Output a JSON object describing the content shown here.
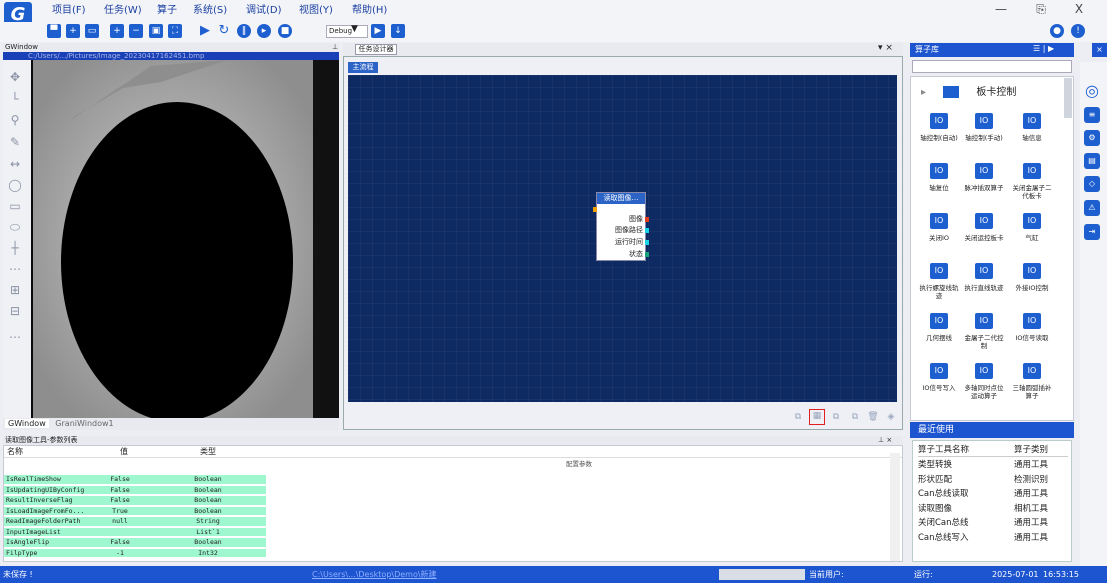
{
  "menu": [
    "项目(F)",
    "任务(W)",
    "算子",
    "系统(S)",
    "调试(D)",
    "视图(Y)",
    "帮助(H)"
  ],
  "window_controls": {
    "minimize": "—",
    "restore": "⎘",
    "close": "X"
  },
  "toolbar": {
    "debug_select": "Debug",
    "icons": [
      "save-icon",
      "new-icon",
      "open-icon",
      "zoom-in-icon",
      "zoom-out-icon",
      "fit-icon",
      "fullscreen-icon",
      "run-icon",
      "loop-icon",
      "pause-icon",
      "step-icon",
      "stop-icon",
      "run-single-icon",
      "export-icon"
    ]
  },
  "gwindow": {
    "title": "GWindow",
    "path": "C:/Users/.../Pictures/Image_20230417162451.bmp",
    "tabs": [
      "GWindow",
      "GraniWindow1"
    ]
  },
  "designer": {
    "tab": "任务设计器",
    "flow_tab": "主流程",
    "node": {
      "title": "读取图像…",
      "ports": [
        "图像",
        "图像路径",
        "运行时间",
        "状态"
      ]
    }
  },
  "library": {
    "title": "算子库",
    "category": "板卡控制",
    "operators": [
      "轴控制(自动)",
      "轴控制(手动)",
      "轴信息",
      "轴复位",
      "脉冲插双算子",
      "关闭金屠子二代板卡",
      "关闭IO",
      "关闭运控板卡",
      "气缸",
      "执行螺旋线轨迹",
      "执行直线轨迹",
      "外接IO控制",
      "几何摆线",
      "金屠子二代控制",
      "IO信号读取",
      "IO信号写入",
      "多轴同时点位运动算子",
      "三轴圆弧插补算子"
    ]
  },
  "recent": {
    "title": "最近使用",
    "headers": [
      "算子工具名称",
      "算子类别"
    ],
    "rows": [
      [
        "类型转换",
        "通用工具"
      ],
      [
        "形状匹配",
        "检测识别"
      ],
      [
        "Can总线读取",
        "通用工具"
      ],
      [
        "读取图像",
        "相机工具"
      ],
      [
        "关闭Can总线",
        "通用工具"
      ],
      [
        "Can总线写入",
        "通用工具"
      ]
    ]
  },
  "params": {
    "title": "读取图像工具-参数列表",
    "headers": [
      "名称",
      "值",
      "类型"
    ],
    "section": "配置参数",
    "rows": [
      [
        "IsRealTimeShow",
        "False",
        "Boolean"
      ],
      [
        "IsUpdatingUIByConfig",
        "False",
        "Boolean"
      ],
      [
        "ResultInverseFlag",
        "False",
        "Boolean"
      ],
      [
        "IsLoadImageFromFo...",
        "True",
        "Boolean"
      ],
      [
        "ReadImageFolderPath",
        "null",
        "String"
      ],
      [
        "InputImageList",
        "",
        "List`1"
      ],
      [
        "IsAngleFlip",
        "False",
        "Boolean"
      ],
      [
        "FilpType",
        "-1",
        "Int32"
      ]
    ]
  },
  "status": {
    "left": "未保存 !",
    "path": "C:\\Users\\...\\Desktop\\Demo\\新建",
    "user_label": "当前用户:",
    "run_label": "运行:",
    "date": "2025-07-01",
    "time": "16:53:15"
  }
}
